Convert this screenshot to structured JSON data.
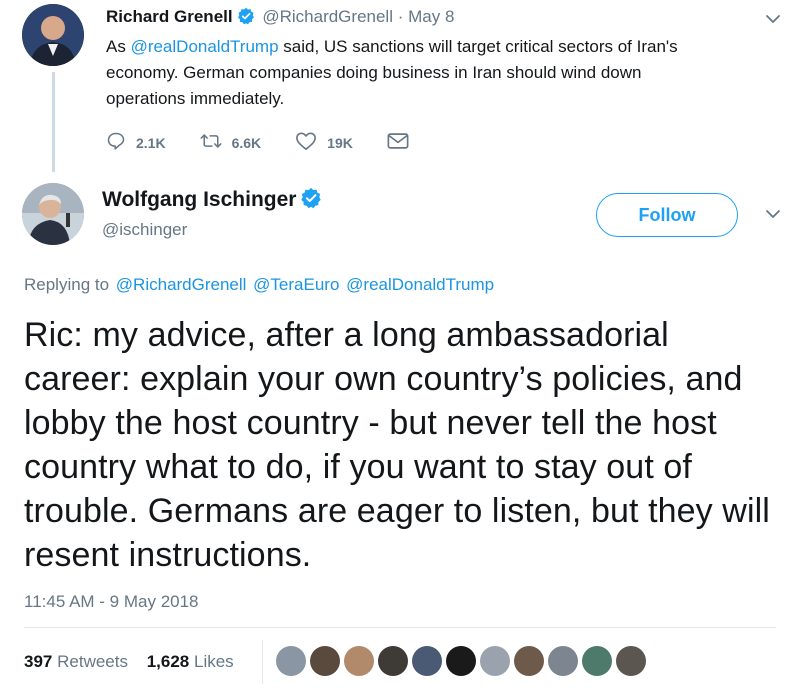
{
  "parent_tweet": {
    "name": "Richard Grenell",
    "handle": "@RichardGrenell",
    "separator": "·",
    "date": "May 8",
    "body_prefix": "As ",
    "body_mention": "@realDonaldTrump",
    "body_rest": " said, US sanctions will target critical sectors of Iran's economy. German companies doing business in Iran should wind down operations immediately.",
    "replies": "2.1K",
    "retweets": "6.6K",
    "likes": "19K"
  },
  "main_tweet": {
    "name": "Wolfgang Ischinger",
    "handle": "@ischinger",
    "follow_label": "Follow",
    "replying_label": "Replying to",
    "replying_to": [
      "@RichardGrenell",
      "@TeraEuro",
      "@realDonaldTrump"
    ],
    "text": "Ric: my advice, after a  long ambassadorial career: explain your own country’s policies, and lobby the host country - but never tell the host country what to do, if you want to stay out of trouble. Germans are eager to listen, but they will resent instructions.",
    "timestamp": "11:45 AM - 9 May 2018",
    "retweet_count": "397",
    "retweet_label": "Retweets",
    "like_count": "1,628",
    "like_label": "Likes"
  },
  "icons": {
    "verified": "verified-badge-icon",
    "reply": "reply-icon",
    "retweet": "retweet-icon",
    "like": "heart-icon",
    "dm": "envelope-icon",
    "menu": "chevron-down-icon"
  },
  "colors": {
    "link": "#1b95e0",
    "brand": "#1da1f2",
    "muted": "#657786",
    "text": "#14171a"
  },
  "liker_avatars": [
    "#8a96a3",
    "#5a4a3e",
    "#b08a6a",
    "#3e3a36",
    "#4a5a74",
    "#1a1a1a",
    "#9aa3ad",
    "#6d5a4a",
    "#7c8590",
    "#4d7a6a",
    "#5b5650"
  ]
}
